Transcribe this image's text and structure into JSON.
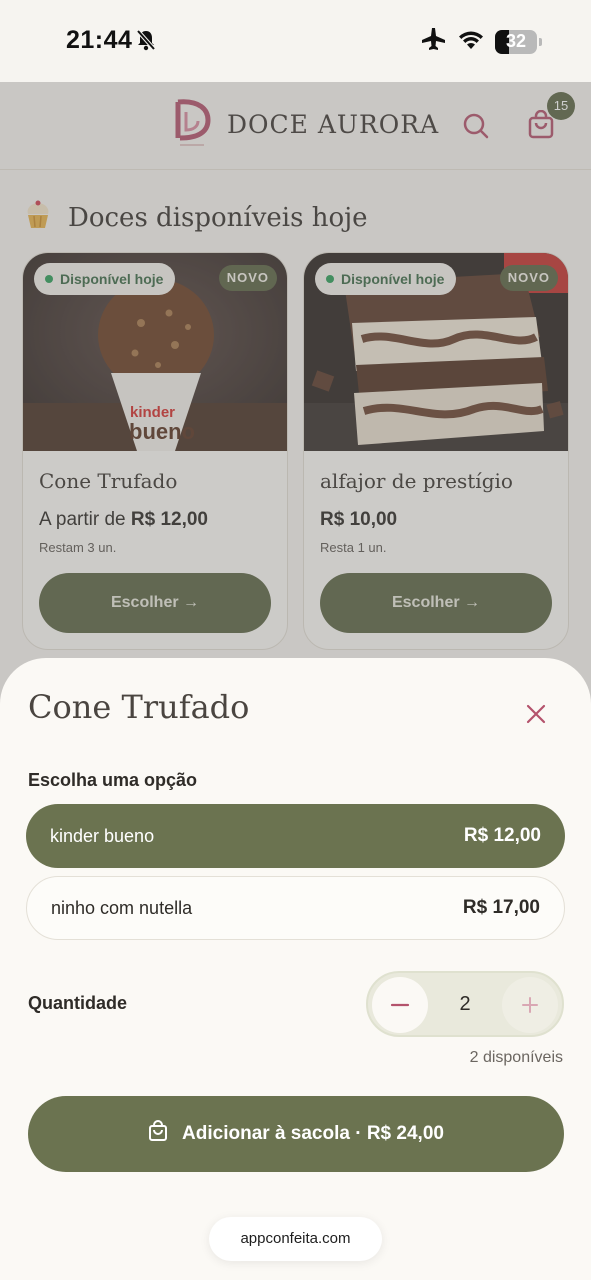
{
  "status": {
    "time": "21:44",
    "battery": "32"
  },
  "header": {
    "brand": "DOCE AURORA",
    "cart_count": "15"
  },
  "section": {
    "title": "Doces disponíveis hoje"
  },
  "products": [
    {
      "name": "Cone Trufado",
      "price_prefix": "A partir de ",
      "price": "R$ 12,00",
      "stock": "Restam 3 un.",
      "badge_available": "Disponível hoje",
      "badge_new": "NOVO",
      "button": "Escolher →"
    },
    {
      "name": "alfajor de prestígio",
      "price_prefix": "",
      "price": "R$ 10,00",
      "stock": "Resta 1 un.",
      "badge_available": "Disponível hoje",
      "badge_new": "NOVO",
      "button": "Escolher →"
    }
  ],
  "sheet": {
    "title": "Cone Trufado",
    "choose_label": "Escolha uma opção",
    "options": [
      {
        "label": "kinder bueno",
        "price": "R$ 12,00",
        "selected": true
      },
      {
        "label": "ninho com nutella",
        "price": "R$ 17,00",
        "selected": false
      }
    ],
    "quantity_label": "Quantidade",
    "quantity": "2",
    "available": "2 disponíveis",
    "add_button": "Adicionar à sacola · R$ 24,00"
  },
  "browser": {
    "url": "appconfeita.com"
  },
  "colors": {
    "olive": "#5d6645",
    "rose": "#b4536c",
    "cream": "#fbf9f5"
  }
}
